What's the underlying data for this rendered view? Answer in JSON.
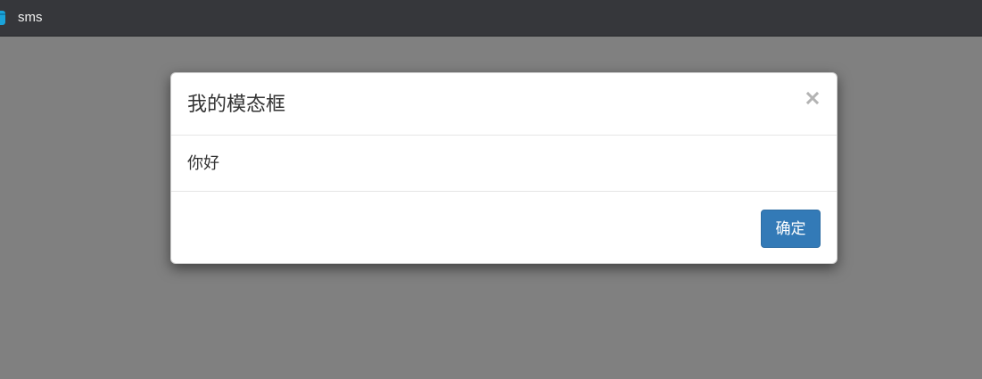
{
  "topbar": {
    "title": "sms",
    "icon": "app-icon",
    "bg_color": "#36373b",
    "icon_color": "#1aa3d9"
  },
  "backdrop": {
    "color": "#808080"
  },
  "modal": {
    "title": "我的模态框",
    "close_symbol": "×",
    "close_icon": "close-icon",
    "body_text": "你好",
    "confirm_label": "确定",
    "confirm_color": "#337ab7"
  }
}
